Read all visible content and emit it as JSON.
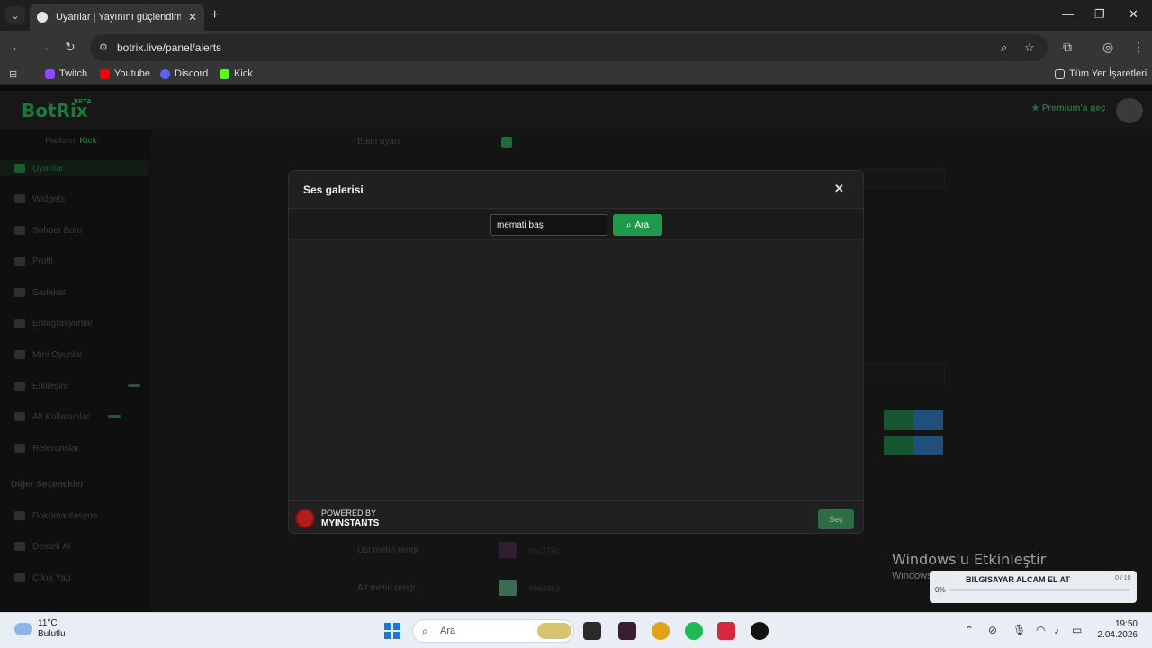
{
  "browser": {
    "tab_title": "Uyarılar | Yayınını güçlendirmek",
    "url": "botrix.live/panel/alerts",
    "bookmarks": [
      "Twitch",
      "Youtube",
      "Discord",
      "Kick"
    ],
    "all_bookmarks": "Tüm Yer İşaretleri"
  },
  "app": {
    "logo": "BotRix",
    "logo_badge": "BETA",
    "premium": "Premium'a geç",
    "platform_label": "Platform:",
    "platform_value": "Kick",
    "sidebar": [
      "Uyarılar",
      "Widgets",
      "Sohbet Botu",
      "Profil",
      "Sadakat",
      "Entegrasyonlar",
      "Mini Oyunlar",
      "Etkileşim",
      "Alt Kullanıcılar",
      "Referanslar"
    ],
    "other_options": "Diğer Seçenekler",
    "other_items": [
      "Dokümantasyon",
      "Destek Al",
      "Çıkış Yap"
    ],
    "bg_labels": {
      "enable": "Etkin uyarı",
      "top_text_color": "Üst metin rengi",
      "bottom_text_color": "Alt metin rengi"
    },
    "bg_hex": {
      "top": "#5c375c",
      "bottom": "#96d9b3"
    }
  },
  "modal": {
    "title": "Ses galerisi",
    "search_value": "memati baş",
    "search_button": "Ara",
    "powered_by": "POWERED BY",
    "powered_brand": "MYINSTANTS",
    "select_button": "Seç"
  },
  "os": {
    "watermark_title": "Windows'u Etkinleştir",
    "watermark_sub": "Windows",
    "toast_title": "BILGISAYAR ALCAM EL AT",
    "toast_percent": "0%",
    "toast_version": "0 / 10",
    "weather_temp": "11°C",
    "weather_desc": "Bulutlu",
    "search_placeholder": "Ara",
    "time": "19:50",
    "date": "2.04.2026"
  },
  "colors": {
    "accent": "#1f9a4a",
    "modal_bg": "#202020",
    "page_bg": "#141414"
  }
}
